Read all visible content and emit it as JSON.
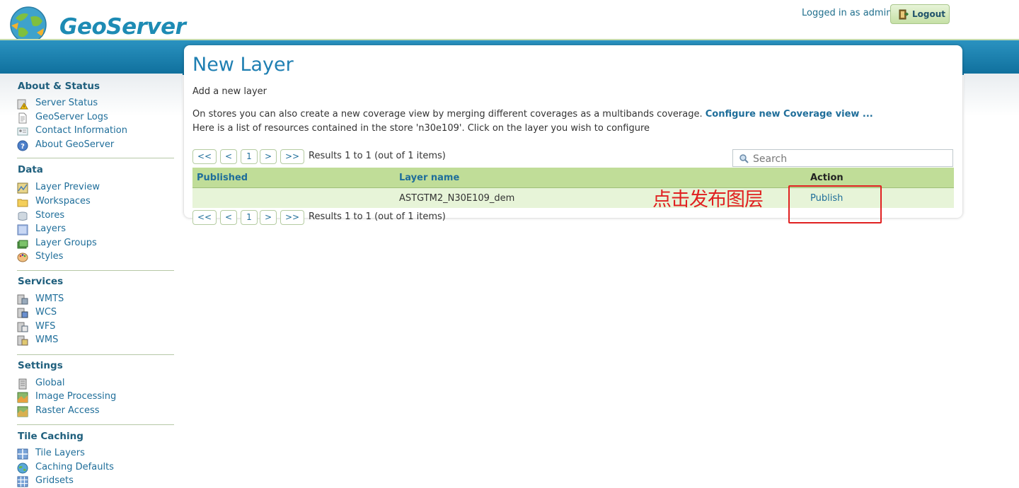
{
  "header": {
    "logo_text": "GeoServer",
    "login_status": "Logged in as admin.",
    "logout_label": "Logout"
  },
  "sidebar": {
    "sections": [
      {
        "title": "About & Status",
        "items": [
          {
            "label": "Server Status",
            "icon": "warning-icon"
          },
          {
            "label": "GeoServer Logs",
            "icon": "document-icon"
          },
          {
            "label": "Contact Information",
            "icon": "contact-card-icon"
          },
          {
            "label": "About GeoServer",
            "icon": "help-icon"
          }
        ]
      },
      {
        "title": "Data",
        "items": [
          {
            "label": "Layer Preview",
            "icon": "map-preview-icon"
          },
          {
            "label": "Workspaces",
            "icon": "folder-icon"
          },
          {
            "label": "Stores",
            "icon": "database-icon"
          },
          {
            "label": "Layers",
            "icon": "layer-icon"
          },
          {
            "label": "Layer Groups",
            "icon": "layer-group-icon"
          },
          {
            "label": "Styles",
            "icon": "palette-icon"
          }
        ]
      },
      {
        "title": "Services",
        "items": [
          {
            "label": "WMTS",
            "icon": "wmts-service-icon"
          },
          {
            "label": "WCS",
            "icon": "wcs-service-icon"
          },
          {
            "label": "WFS",
            "icon": "wfs-service-icon"
          },
          {
            "label": "WMS",
            "icon": "wms-service-icon"
          }
        ]
      },
      {
        "title": "Settings",
        "items": [
          {
            "label": "Global",
            "icon": "server-icon"
          },
          {
            "label": "Image Processing",
            "icon": "image-processing-icon"
          },
          {
            "label": "Raster Access",
            "icon": "raster-access-icon"
          }
        ]
      },
      {
        "title": "Tile Caching",
        "items": [
          {
            "label": "Tile Layers",
            "icon": "tile-layers-icon"
          },
          {
            "label": "Caching Defaults",
            "icon": "globe-icon"
          },
          {
            "label": "Gridsets",
            "icon": "grid-icon"
          }
        ]
      }
    ]
  },
  "main": {
    "title": "New Layer",
    "subtitle": "Add a new layer",
    "info_line1": "On stores you can also create a new coverage view by merging different coverages as a multibands coverage.",
    "info_link": "Configure new Coverage view ...",
    "info_line2": "Here is a list of resources contained in the store 'n30e109'. Click on the layer you wish to configure",
    "pager": {
      "first": "<<",
      "prev": "<",
      "page": "1",
      "next": ">",
      "last": ">>",
      "results": "Results 1 to 1 (out of 1 items)"
    },
    "search_placeholder": "Search",
    "table": {
      "columns": [
        "Published",
        "Layer name",
        "Action"
      ],
      "rows": [
        {
          "published": "",
          "layer_name": "ASTGTM2_N30E109_dem",
          "action": "Publish"
        }
      ]
    }
  },
  "annotation": {
    "text": "点击发布图层",
    "color": "#e02020"
  },
  "colors": {
    "accent_blue": "#1f7fb2",
    "header_green": "#c0dd98",
    "row_green": "#e7f4d8"
  }
}
